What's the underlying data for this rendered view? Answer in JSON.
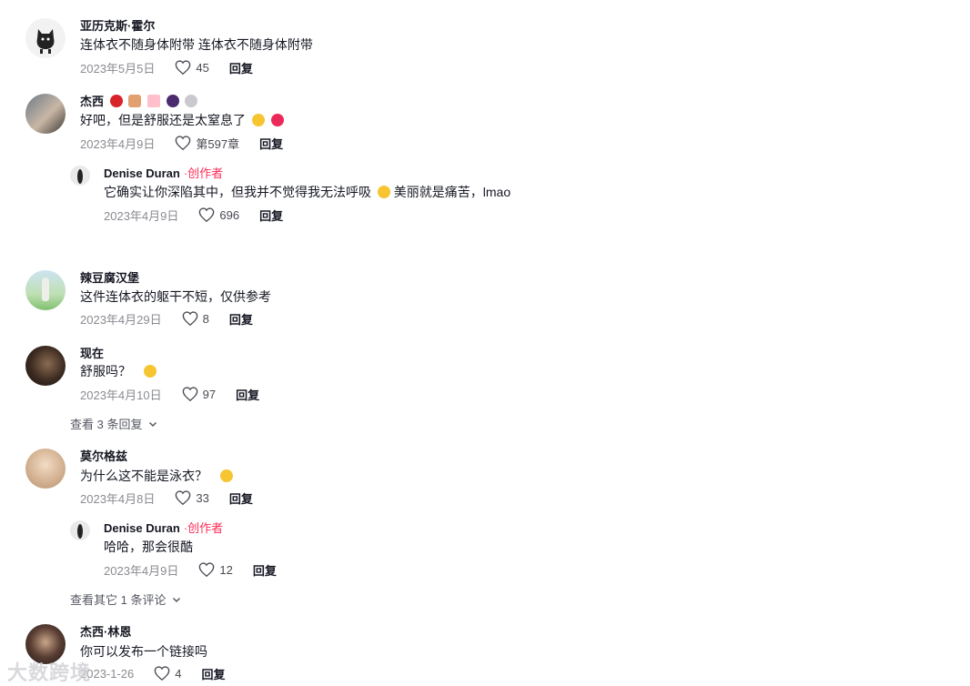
{
  "comments": [
    {
      "name": "亚历克斯·霍尔",
      "text": "连体衣不随身体附带 连体衣不随身体附带",
      "date": "2023年5月5日",
      "likes": "45",
      "reply": "回复"
    },
    {
      "name": "杰西",
      "text": "好吧，但是舒服还是太窒息了",
      "date": "2023年4月9日",
      "likes": "第597章",
      "reply": "回复",
      "sub": {
        "name": "Denise Duran",
        "tag": "·创作者",
        "text": "它确实让你深陷其中，但我并不觉得我无法呼吸",
        "text_after": "美丽就是痛苦，lmao",
        "date": "2023年4月9日",
        "likes": "696",
        "reply": "回复"
      }
    },
    {
      "name": "辣豆腐汉堡",
      "text": "这件连体衣的躯干不短，仅供参考",
      "date": "2023年4月29日",
      "likes": "8",
      "reply": "回复"
    },
    {
      "name": "现在",
      "text": "舒服吗？",
      "date": "2023年4月10日",
      "likes": "97",
      "reply": "回复",
      "view_more": "查看 3 条回复"
    },
    {
      "name": "莫尔格兹",
      "text": "为什么这不能是泳衣？",
      "date": "2023年4月8日",
      "likes": "33",
      "reply": "回复",
      "sub": {
        "name": "Denise Duran",
        "tag": "·创作者",
        "text": "哈哈，那会很酷",
        "date": "2023年4月9日",
        "likes": "12",
        "reply": "回复"
      },
      "view_more": "查看其它 1 条评论"
    },
    {
      "name": "杰西·林恩",
      "text": "你可以发布一个链接吗",
      "date": "2023-1-26",
      "likes": "4",
      "reply": "回复"
    }
  ],
  "colors": {
    "author": "#fe2c55",
    "text": "#161823",
    "meta": "#8a8b91"
  },
  "watermark": "大数跨境"
}
